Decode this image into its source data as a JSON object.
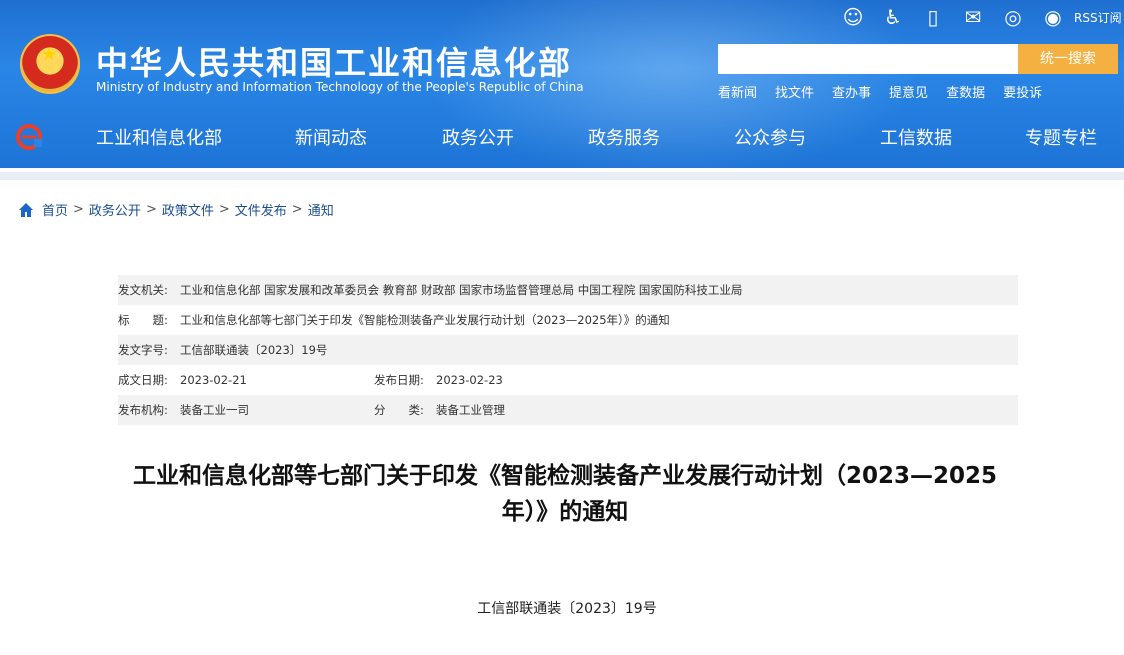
{
  "header": {
    "site_title": "中华人民共和国工业和信息化部",
    "site_subtitle": "Ministry of Industry and Information Technology of the People's Republic of China",
    "top_icons": [
      "robot-icon",
      "accessibility-icon",
      "mobile-icon",
      "mail-icon",
      "wechat-icon",
      "weibo-icon"
    ],
    "rss_label": "RSS订阅",
    "search": {
      "placeholder": "",
      "button_label": "统一搜索"
    },
    "quick_links": [
      "看新闻",
      "找文件",
      "查办事",
      "提意见",
      "查数据",
      "要投诉"
    ]
  },
  "nav": {
    "items": [
      "工业和信息化部",
      "新闻动态",
      "政务公开",
      "政务服务",
      "公众参与",
      "工信数据",
      "专题专栏"
    ]
  },
  "breadcrumb": {
    "items": [
      "首页",
      "政务公开",
      "政策文件",
      "文件发布",
      "通知"
    ]
  },
  "meta": {
    "issuer_label": "发文机关:",
    "issuer": "工业和信息化部 国家发展和改革委员会 教育部 财政部 国家市场监督管理总局 中国工程院 国家国防科技工业局",
    "title_label": "标　　题:",
    "title": "工业和信息化部等七部门关于印发《智能检测装备产业发展行动计划（2023—2025年）》的通知",
    "doc_no_label": "发文字号:",
    "doc_no": "工信部联通装〔2023〕19号",
    "created_label": "成文日期:",
    "created": "2023-02-21",
    "published_label": "发布日期:",
    "published": "2023-02-23",
    "org_label": "发布机构:",
    "org": "装备工业一司",
    "category_label": "分　　类:",
    "category": "装备工业管理"
  },
  "article": {
    "title_line1": "工业和信息化部等七部门关于印发《智能检测装备产业发展行动计划（2023—2025",
    "title_line2": "年）》的通知",
    "doc_number": "工信部联通装〔2023〕19号"
  },
  "colors": {
    "header_blue": "#1f6fd0",
    "search_button": "#f5b042",
    "breadcrumb_link": "#1a4d8f"
  }
}
